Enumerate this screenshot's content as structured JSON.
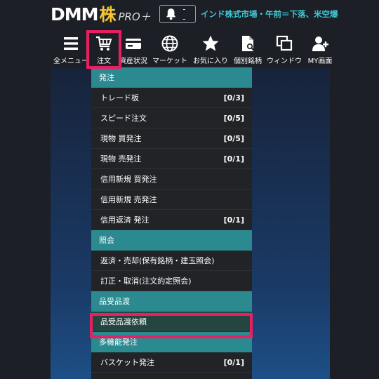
{
  "header": {
    "logo_text": "DMM",
    "logo_kabu": "株",
    "logo_pro": "PRO＋",
    "notification_count": "- -",
    "ticker": "インド株式市場・午前＝下落、米空爆"
  },
  "nav": {
    "items": [
      {
        "label": "全メニュー",
        "icon": "hamburger-icon"
      },
      {
        "label": "注文",
        "icon": "cart-icon"
      },
      {
        "label": "資産状況",
        "icon": "wallet-icon"
      },
      {
        "label": "マーケット",
        "icon": "globe-icon"
      },
      {
        "label": "お気に入り",
        "icon": "star-icon"
      },
      {
        "label": "個別銘柄",
        "icon": "document-search-icon"
      },
      {
        "label": "ウィンドウ",
        "icon": "windows-icon"
      },
      {
        "label": "MY画面",
        "icon": "user-add-icon"
      }
    ]
  },
  "colors": {
    "accent_pink": "#e91e63",
    "section_teal": "#2b8a8f",
    "ticker_cyan": "#3fc6d4",
    "logo_yellow": "#f3c534"
  },
  "menu": {
    "rows": [
      {
        "label": "発注",
        "type": "section"
      },
      {
        "label": "トレード板",
        "count": "[0/3]"
      },
      {
        "label": "スピード注文",
        "count": "[0/5]"
      },
      {
        "label": "現物 買発注",
        "count": "[0/5]"
      },
      {
        "label": "現物 売発注",
        "count": "[0/1]"
      },
      {
        "label": "信用新規 買発注",
        "count": ""
      },
      {
        "label": "信用新規 売発注",
        "count": ""
      },
      {
        "label": "信用返済 発注",
        "count": "[0/1]"
      },
      {
        "label": "照会",
        "type": "section"
      },
      {
        "label": "返済・売却(保有銘柄・建玉照会)",
        "count": ""
      },
      {
        "label": "訂正・取消(注文約定照会)",
        "count": ""
      },
      {
        "label": "品受品渡",
        "type": "section"
      },
      {
        "label": "品受品渡依頼",
        "count": "",
        "selected": true
      },
      {
        "label": "多機能発注",
        "type": "section"
      },
      {
        "label": "バスケット発注",
        "count": "[0/1]"
      }
    ]
  }
}
